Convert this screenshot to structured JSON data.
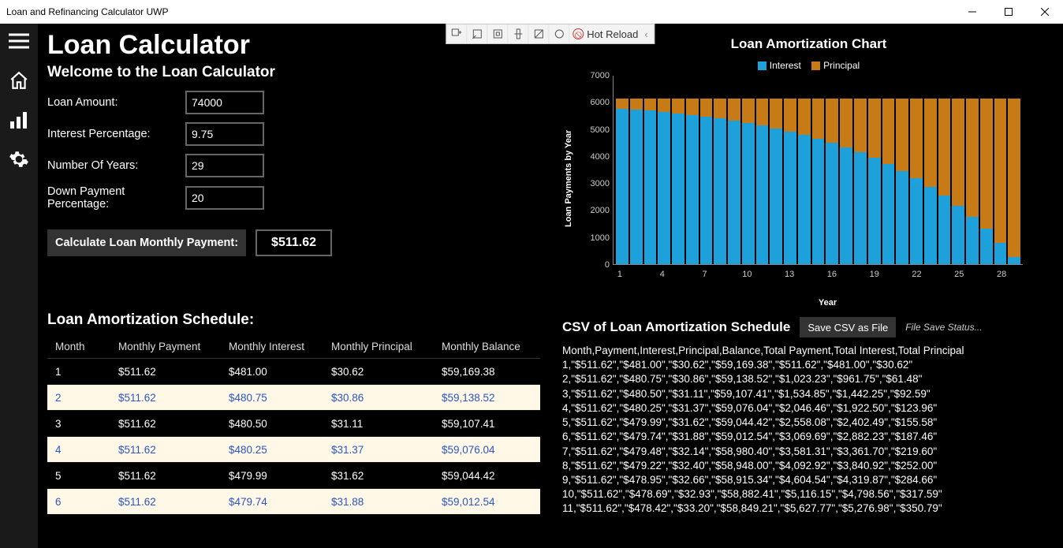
{
  "window": {
    "title": "Loan and Refinancing Calculator UWP"
  },
  "vs_toolbar": {
    "hot_reload": "Hot Reload"
  },
  "app_title": "Loan Calculator",
  "welcome": "Welcome to the Loan Calculator",
  "form": {
    "loan_amount_label": "Loan Amount:",
    "loan_amount_value": "74000",
    "interest_label": "Interest Percentage:",
    "interest_value": "9.75",
    "years_label": "Number Of Years:",
    "years_value": "29",
    "down_label": "Down Payment Percentage:",
    "down_value": "20",
    "calc_button": "Calculate Loan Monthly Payment:",
    "result": "$511.62"
  },
  "schedule": {
    "title": "Loan Amortization Schedule:",
    "headers": {
      "c1": "Month",
      "c2": "Monthly Payment",
      "c3": "Monthly Interest",
      "c4": "Monthly Principal",
      "c5": "Monthly Balance"
    },
    "rows": [
      {
        "m": "1",
        "p": "$511.62",
        "i": "$481.00",
        "pr": "$30.62",
        "b": "$59,169.38"
      },
      {
        "m": "2",
        "p": "$511.62",
        "i": "$480.75",
        "pr": "$30.86",
        "b": "$59,138.52"
      },
      {
        "m": "3",
        "p": "$511.62",
        "i": "$480.50",
        "pr": "$31.11",
        "b": "$59,107.41"
      },
      {
        "m": "4",
        "p": "$511.62",
        "i": "$480.25",
        "pr": "$31.37",
        "b": "$59,076.04"
      },
      {
        "m": "5",
        "p": "$511.62",
        "i": "$479.99",
        "pr": "$31.62",
        "b": "$59,044.42"
      },
      {
        "m": "6",
        "p": "$511.62",
        "i": "$479.74",
        "pr": "$31.88",
        "b": "$59,012.54"
      }
    ]
  },
  "chart_title": "Loan Amortization Chart",
  "legend": {
    "interest": "Interest",
    "principal": "Principal"
  },
  "colors": {
    "interest": "#1ea0db",
    "principal": "#c77b17"
  },
  "chart_data": {
    "type": "bar",
    "title": "Loan Amortization Chart",
    "xlabel": "Year",
    "ylabel": "Loan Payments by Year",
    "ylim": [
      0,
      7000
    ],
    "yticks": [
      0,
      1000,
      2000,
      3000,
      4000,
      5000,
      6000,
      7000
    ],
    "xticks": [
      1,
      4,
      7,
      10,
      13,
      16,
      19,
      22,
      25,
      28
    ],
    "categories": [
      1,
      2,
      3,
      4,
      5,
      6,
      7,
      8,
      9,
      10,
      11,
      12,
      13,
      14,
      15,
      16,
      17,
      18,
      19,
      20,
      21,
      22,
      23,
      24,
      25,
      26,
      27,
      28,
      29
    ],
    "stack_total": 6139,
    "series": [
      {
        "name": "Interest",
        "color": "#1ea0db",
        "values": [
          5759,
          5720,
          5677,
          5629,
          5577,
          5519,
          5455,
          5385,
          5307,
          5222,
          5127,
          5024,
          4909,
          4783,
          4644,
          4490,
          4321,
          4134,
          3928,
          3701,
          3450,
          3174,
          2868,
          2532,
          2160,
          1750,
          1299,
          800,
          250
        ]
      },
      {
        "name": "Principal",
        "color": "#c77b17",
        "values": [
          380,
          419,
          462,
          510,
          562,
          620,
          684,
          754,
          832,
          917,
          1012,
          1115,
          1230,
          1356,
          1495,
          1649,
          1818,
          2005,
          2211,
          2438,
          2689,
          2965,
          3271,
          3607,
          3979,
          4389,
          4840,
          5339,
          5889
        ]
      }
    ]
  },
  "csv": {
    "title": "CSV of Loan Amortization Schedule",
    "button": "Save CSV as File",
    "status": "File Save Status...",
    "header_line": "Month,Payment,Interest,Principal,Balance,Total Payment,Total Interest,Total Principal",
    "lines": [
      "1,\"$511.62\",\"$481.00\",\"$30.62\",\"$59,169.38\",\"$511.62\",\"$481.00\",\"$30.62\"",
      "2,\"$511.62\",\"$480.75\",\"$30.86\",\"$59,138.52\",\"$1,023.23\",\"$961.75\",\"$61.48\"",
      "3,\"$511.62\",\"$480.50\",\"$31.11\",\"$59,107.41\",\"$1,534.85\",\"$1,442.25\",\"$92.59\"",
      "4,\"$511.62\",\"$480.25\",\"$31.37\",\"$59,076.04\",\"$2,046.46\",\"$1,922.50\",\"$123.96\"",
      "5,\"$511.62\",\"$479.99\",\"$31.62\",\"$59,044.42\",\"$2,558.08\",\"$2,402.49\",\"$155.58\"",
      "6,\"$511.62\",\"$479.74\",\"$31.88\",\"$59,012.54\",\"$3,069.69\",\"$2,882.23\",\"$187.46\"",
      "7,\"$511.62\",\"$479.48\",\"$32.14\",\"$58,980.40\",\"$3,581.31\",\"$3,361.70\",\"$219.60\"",
      "8,\"$511.62\",\"$479.22\",\"$32.40\",\"$58,948.00\",\"$4,092.92\",\"$3,840.92\",\"$252.00\"",
      "9,\"$511.62\",\"$478.95\",\"$32.66\",\"$58,915.34\",\"$4,604.54\",\"$4,319.87\",\"$284.66\"",
      "10,\"$511.62\",\"$478.69\",\"$32.93\",\"$58,882.41\",\"$5,116.15\",\"$4,798.56\",\"$317.59\"",
      "11,\"$511.62\",\"$478.42\",\"$33.20\",\"$58,849.21\",\"$5,627.77\",\"$5,276.98\",\"$350.79\""
    ]
  },
  "xlabel_text": "Year",
  "ylabel_text": "Loan Payments by Year"
}
